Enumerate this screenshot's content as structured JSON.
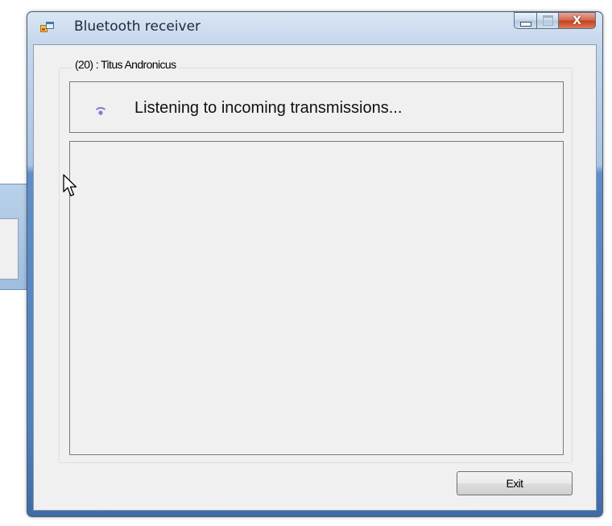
{
  "window": {
    "title": "Bluetooth receiver",
    "icons": {
      "app": "app-window-icon",
      "minimize": "minimize-icon",
      "maximize": "maximize-icon",
      "close": "close-icon"
    },
    "close_glyph": "X"
  },
  "group": {
    "label": "(20) : Titus Andronicus"
  },
  "status": {
    "icon": "wireless-signal-icon",
    "text": "Listening to incoming transmissions..."
  },
  "log": {
    "entries": []
  },
  "buttons": {
    "exit_label": "Exit"
  },
  "colors": {
    "signal_icon": "#7b7bd9",
    "close_button": "#c4401f",
    "client_background": "#f0f0f0"
  }
}
